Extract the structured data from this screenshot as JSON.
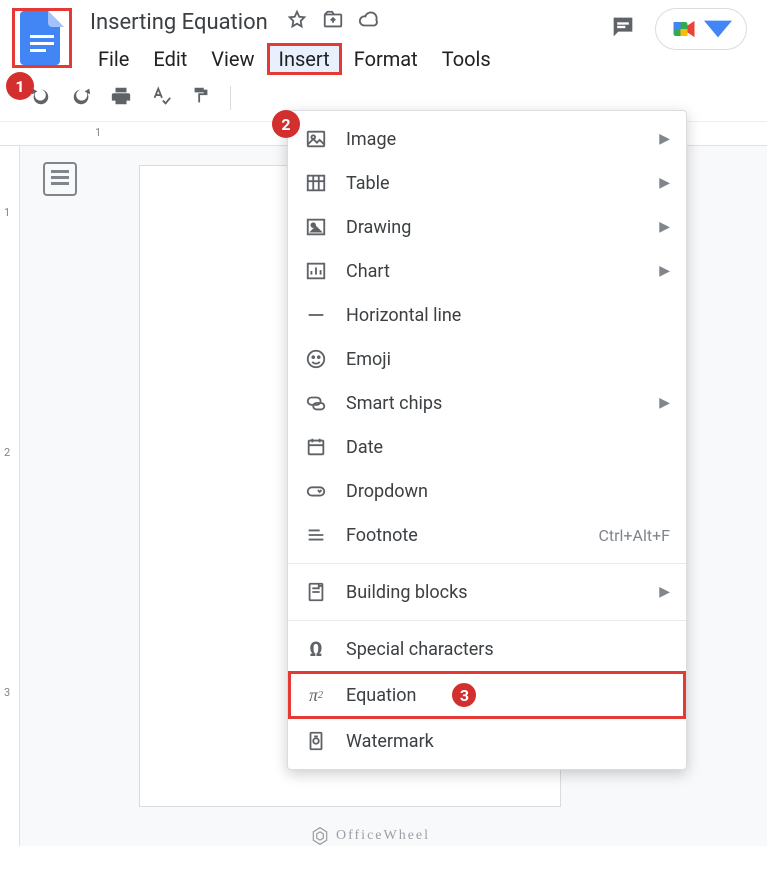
{
  "document": {
    "title": "Inserting Equation"
  },
  "menubar": {
    "file": "File",
    "edit": "Edit",
    "view": "View",
    "insert": "Insert",
    "format": "Format",
    "tools": "Tools"
  },
  "ruler": {
    "label1": "1"
  },
  "vruler": {
    "v1": "1",
    "v2": "2",
    "v3": "3"
  },
  "insert_menu": {
    "image": {
      "label": "Image",
      "has_sub": true
    },
    "table": {
      "label": "Table",
      "has_sub": true
    },
    "drawing": {
      "label": "Drawing",
      "has_sub": true
    },
    "chart": {
      "label": "Chart",
      "has_sub": true
    },
    "hline": {
      "label": "Horizontal line",
      "has_sub": false
    },
    "emoji": {
      "label": "Emoji",
      "has_sub": false
    },
    "smartchips": {
      "label": "Smart chips",
      "has_sub": true
    },
    "date": {
      "label": "Date",
      "has_sub": false
    },
    "dropdown": {
      "label": "Dropdown",
      "has_sub": false
    },
    "footnote": {
      "label": "Footnote",
      "shortcut": "Ctrl+Alt+F",
      "has_sub": false
    },
    "blocks": {
      "label": "Building blocks",
      "has_sub": true
    },
    "specialchars": {
      "label": "Special characters",
      "has_sub": false
    },
    "equation": {
      "label": "Equation",
      "has_sub": false
    },
    "watermark": {
      "label": "Watermark",
      "has_sub": false
    }
  },
  "annotations": {
    "step1": "1",
    "step2": "2",
    "step3": "3"
  },
  "brand_watermark": "OfficeWheel"
}
